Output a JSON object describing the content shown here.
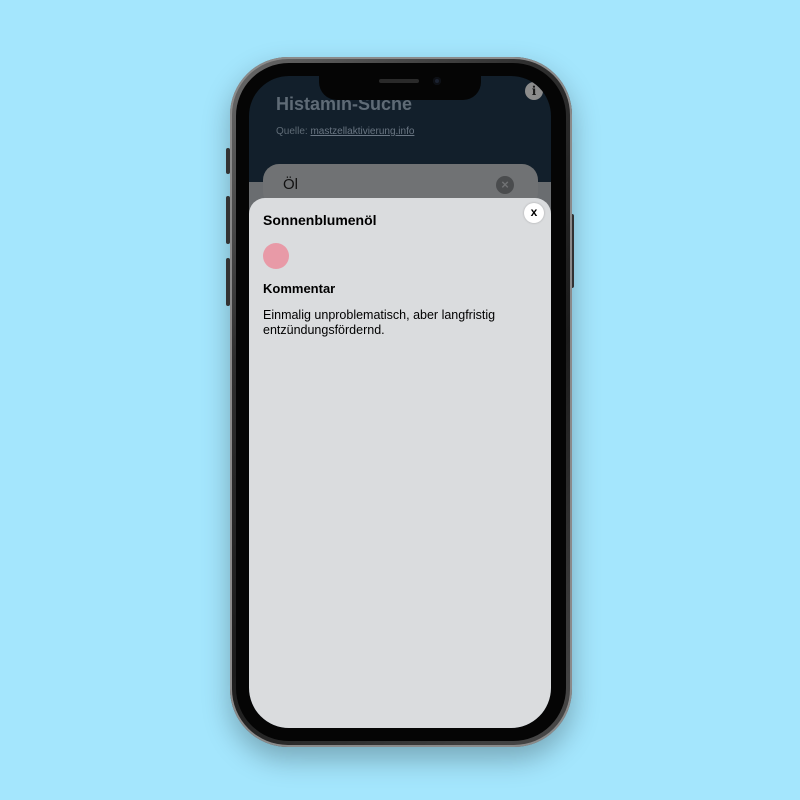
{
  "app": {
    "title": "Histamin-Suche",
    "source_prefix": "Quelle: ",
    "source_link": "mastzellaktivierung.info",
    "info_icon": "info-icon",
    "info_label": "i"
  },
  "search": {
    "value": "Öl",
    "clear_icon": "clear-circle-icon",
    "clear_glyph": "×"
  },
  "modal": {
    "title": "Sonnenblumenöl",
    "close_label": "x",
    "status_color": "#e89aa7",
    "comment_heading": "Kommentar",
    "comment_text": "Einmalig unproblematisch, aber langfristig entzündungsfördernd."
  },
  "colors": {
    "background": "#a4e6fd",
    "app_header": "#121f2b",
    "modal_bg": "#dadcde"
  }
}
